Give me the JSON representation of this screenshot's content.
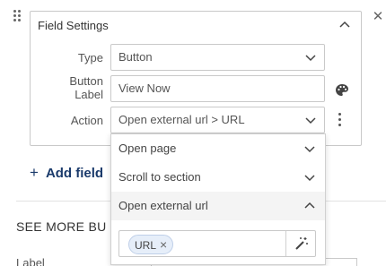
{
  "panel": {
    "title": "Field Settings",
    "close_icon": "close-icon",
    "collapse_icon": "chevron-up-icon"
  },
  "fields": {
    "type": {
      "label": "Type",
      "value": "Button"
    },
    "button_label": {
      "label": "Button\nLabel",
      "value": "View Now"
    },
    "action": {
      "label": "Action",
      "value": "Open external url > URL"
    }
  },
  "action_menu": {
    "options": [
      {
        "label": "Open page",
        "expanded": false
      },
      {
        "label": "Scroll to section",
        "expanded": false
      },
      {
        "label": "Open external url",
        "expanded": true
      }
    ],
    "url_chip": "URL"
  },
  "add_field": {
    "label": "Add field"
  },
  "see_more": {
    "label": "SEE MORE BU"
  },
  "label_cut": {
    "label": "Label"
  },
  "icons": [
    "drag-handle-icon",
    "palette-icon",
    "kebab-menu-icon",
    "magic-wand-icon",
    "chevron-down-icon"
  ]
}
